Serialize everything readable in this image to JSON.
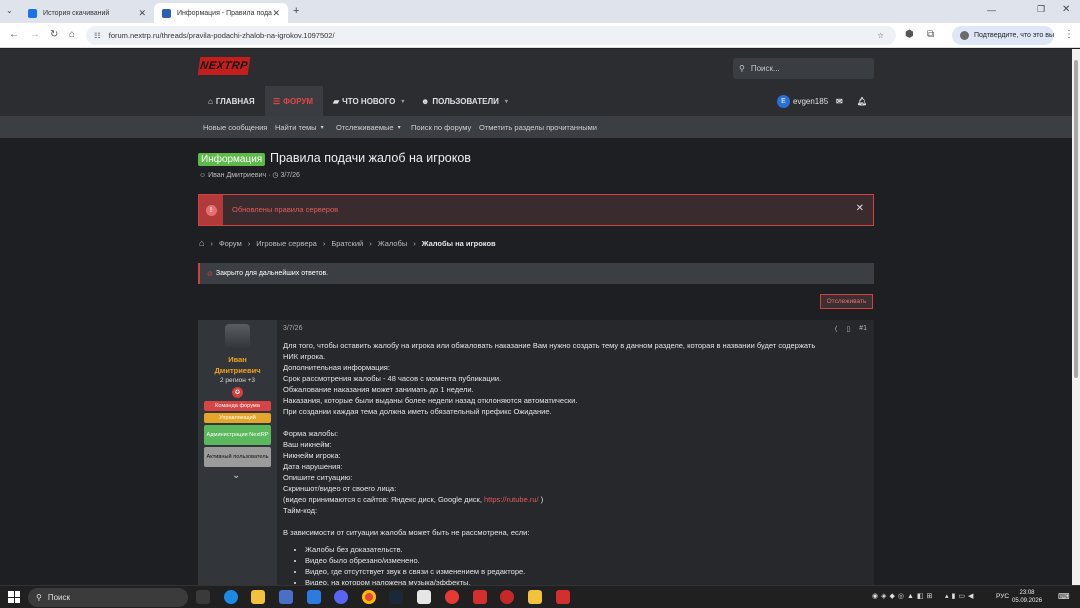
{
  "browser": {
    "tabs": [
      {
        "label": "История скачиваний",
        "active": false
      },
      {
        "label": "Информация - Правила пода",
        "active": true
      }
    ],
    "url": "forum.nextrp.ru/threads/pravila-podachi-zhalob-na-igrokov.1097502/",
    "confirm_label": "Подтвердите, что это вы"
  },
  "site": {
    "logo": "NEXTRP",
    "search_placeholder": "Поиск...",
    "nav": {
      "home": "ГЛАВНАЯ",
      "forums": "ФОРУМ",
      "whats_new": "ЧТО НОВОГО",
      "members": "ПОЛЬЗОВАТЕЛИ",
      "user": "evgen185",
      "avatar_letter": "E"
    },
    "subnav": [
      "Новые сообщения",
      "Найти темы",
      "Отслеживаемые",
      "Поиск по форуму",
      "Отметить разделы прочитанными"
    ],
    "thread": {
      "prefix": "Информация",
      "title": "Правила подачи жалоб на игроков",
      "author": "Иван Дмитриевич",
      "date": "3/7/26"
    },
    "alert": "Обновлены правила серверов",
    "breadcrumbs": [
      "Форум",
      "Игровые сервера",
      "Братский",
      "Жалобы",
      "Жалобы на игроков"
    ],
    "closed_notice": "Закрыто для дальнейших ответов.",
    "follow_button": "Отслеживать",
    "post": {
      "user_name_line1": "Иван",
      "user_name_line2": "Дмитриевич",
      "user_title": "2 регион +3",
      "badges": [
        "Команда форума",
        "Управляющий",
        "Администрация NextRP",
        "Активный пользователь"
      ],
      "badge_colors": [
        "#d64545",
        "#e3a52a",
        "#5cb85c",
        "#9b9b9b"
      ],
      "date": "3/7/26",
      "number": "#1",
      "intro": "Для того, чтобы оставить жалобу на игрока или обжаловать наказание Вам нужно создать тему в данном разделе, которая в названии будет содержать",
      "intro2": "НИК игрока.",
      "info_lines": [
        "Дополнительная информация:",
        "Срок рассмотрения жалобы - 48 часов с момента публикации.",
        "Обжалование наказания может занимать до 1 недели.",
        "Наказания, которые были выданы более недели назад отклоняются автоматически.",
        "При создании каждая тема должна иметь обязательный префикс Ожидание."
      ],
      "form_lines": [
        "Форма жалобы:",
        "Ваш никнейм:",
        "Никнейм игрока:",
        "Дата нарушения:",
        "Опишите ситуацию:",
        "Скриншот/видео от своего лица:"
      ],
      "video_prefix": "(видео принимаются с сайтов: Яндекс диск, Google диск, ",
      "video_link": "https://rutube.ru/",
      "video_suffix": " )",
      "timecode": "Тайм-код:",
      "reject_title": "В зависимости от ситуации жалоба может быть не рассмотрена, если:",
      "reject_items": [
        "Жалобы без доказательств.",
        "Видео было обрезано/изменено.",
        "Видео, где отсутствует звук в связи с изменением в редакторе.",
        "Видео, на котором наложена музыка/эффекты."
      ]
    }
  },
  "taskbar": {
    "search": "Поиск",
    "lang": "РУС",
    "time": "23:08",
    "date": "05.09.2026"
  }
}
